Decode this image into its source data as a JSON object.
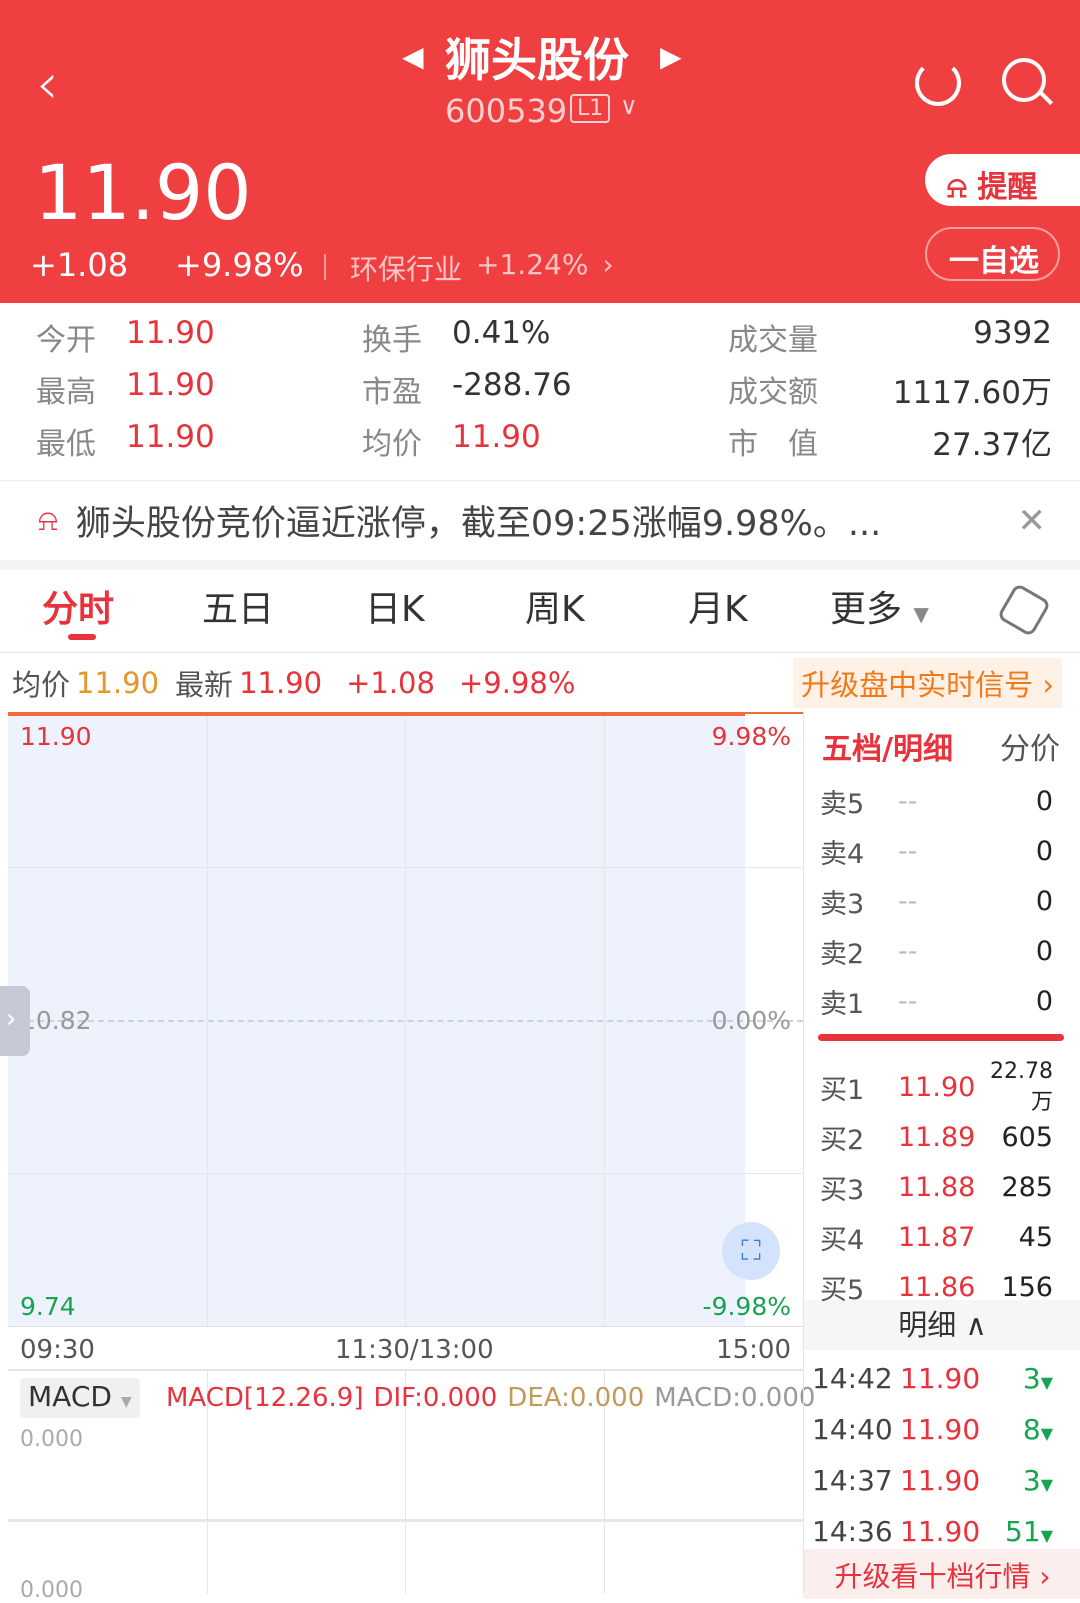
{
  "header": {
    "title": "狮头股份",
    "code": "600539",
    "level_badge": "L1",
    "price": "11.90",
    "change": "+1.08",
    "change_pct": "+9.98%",
    "industry": "环保行业",
    "industry_change": "+1.24%",
    "remind_label": "提醒",
    "watchlist_label": "自选",
    "colors": {
      "header_bg": "#ef3f41",
      "up": "#e8323c",
      "down": "#16a451"
    }
  },
  "stats": [
    {
      "label": "今开",
      "value": "11.90",
      "color": "red"
    },
    {
      "label": "换手",
      "value": "0.41%",
      "color": "dark"
    },
    {
      "label": "成交量",
      "value": "9392",
      "color": "dark"
    },
    {
      "label": "最高",
      "value": "11.90",
      "color": "red"
    },
    {
      "label": "市盈",
      "value": "-288.76",
      "color": "dark"
    },
    {
      "label": "成交额",
      "value": "1117.60万",
      "color": "dark"
    },
    {
      "label": "最低",
      "value": "11.90",
      "color": "red"
    },
    {
      "label": "均价",
      "value": "11.90",
      "color": "red"
    },
    {
      "label": "市　值",
      "value": "27.37亿",
      "color": "dark"
    }
  ],
  "notice": {
    "text": "狮头股份竞价逼近涨停，截至09:25涨幅9.98%。..."
  },
  "tabs": [
    {
      "label": "分时",
      "active": true
    },
    {
      "label": "五日"
    },
    {
      "label": "日K"
    },
    {
      "label": "周K"
    },
    {
      "label": "月K"
    },
    {
      "label": "更多"
    }
  ],
  "info_row": {
    "avg_label": "均价",
    "avg": "11.90",
    "latest_label": "最新",
    "latest": "11.90",
    "change": "+1.08",
    "change_pct": "+9.98%",
    "upgrade": "升级盘中实时信号"
  },
  "chart_data": {
    "type": "line",
    "title": "",
    "y_left_ticks": [
      "11.90",
      "10.82",
      "9.74"
    ],
    "y_right_ticks": [
      "9.98%",
      "0.00%",
      "-9.98%"
    ],
    "x_ticks": [
      "09:30",
      "11:30/13:00",
      "15:00"
    ],
    "ylim": [
      9.74,
      11.9
    ],
    "series": [
      {
        "values": [
          11.9,
          11.9
        ]
      }
    ],
    "prev_close": 10.82,
    "grid": true
  },
  "macd": {
    "selector": "MACD",
    "params": "MACD[12.26.9]",
    "dif": "DIF:0.000",
    "dea": "DEA:0.000",
    "macd": "MACD:0.000",
    "top_tick": "0.000",
    "bottom_tick": "0.000"
  },
  "orderbook": {
    "tab_active": "五档/明细",
    "tab_other": "分价",
    "asks": [
      {
        "label": "卖5",
        "price": "--",
        "vol": "0"
      },
      {
        "label": "卖4",
        "price": "--",
        "vol": "0"
      },
      {
        "label": "卖3",
        "price": "--",
        "vol": "0"
      },
      {
        "label": "卖2",
        "price": "--",
        "vol": "0"
      },
      {
        "label": "卖1",
        "price": "--",
        "vol": "0"
      }
    ],
    "bids": [
      {
        "label": "买1",
        "price": "11.90",
        "vol": "22.78万"
      },
      {
        "label": "买2",
        "price": "11.89",
        "vol": "605"
      },
      {
        "label": "买3",
        "price": "11.88",
        "vol": "285"
      },
      {
        "label": "买4",
        "price": "11.87",
        "vol": "45"
      },
      {
        "label": "买5",
        "price": "11.86",
        "vol": "156"
      }
    ],
    "detail_label": "明细",
    "ticks": [
      {
        "time": "14:42",
        "price": "11.90",
        "vol": "3"
      },
      {
        "time": "14:40",
        "price": "11.90",
        "vol": "8"
      },
      {
        "time": "14:37",
        "price": "11.90",
        "vol": "3"
      },
      {
        "time": "14:36",
        "price": "11.90",
        "vol": "51"
      }
    ],
    "upgrade": "升级看十档行情"
  }
}
